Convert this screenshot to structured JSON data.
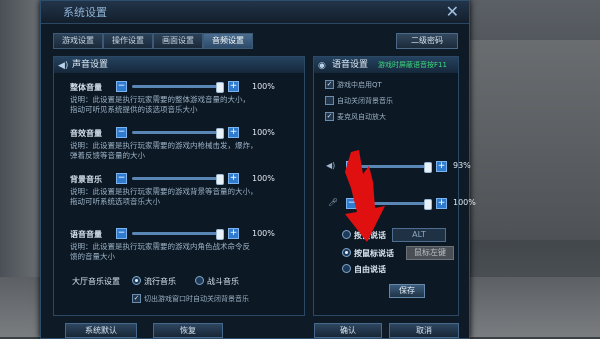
{
  "window": {
    "title": "系统设置"
  },
  "tabs": [
    {
      "label": "游戏设置"
    },
    {
      "label": "操作设置"
    },
    {
      "label": "画面设置"
    },
    {
      "label": "音频设置"
    }
  ],
  "secondary_password_button": "二级密码",
  "sound_panel": {
    "title": "声音设置",
    "rows": [
      {
        "label": "整体音量",
        "value": "100%",
        "level": 1.0,
        "desc1": "说明：此设置是执行玩家需要的整体游戏音量的大小，",
        "desc2": "指动可听见系统提供的该选项音乐大小"
      },
      {
        "label": "音效音量",
        "value": "100%",
        "level": 1.0,
        "desc1": "说明：此设置是执行玩家需要的游戏内枪械击发，爆炸，",
        "desc2": "弹着反馈等音量的大小"
      },
      {
        "label": "背景音乐",
        "value": "100%",
        "level": 1.0,
        "desc1": "说明：此设置是执行玩家需要的游戏背景等音量的大小，",
        "desc2": "拖动可听系统选项音乐大小"
      },
      {
        "label": "语音音量",
        "value": "100%",
        "level": 1.0,
        "desc1": "说明：此设置是执行玩家需要的游戏内角色战术命令反",
        "desc2": "馈的音量大小"
      }
    ],
    "lobby_music": {
      "label": "大厅音乐设置",
      "options": [
        "流行音乐",
        "战斗音乐"
      ],
      "selected": "流行音乐"
    },
    "auto_bgm_off": {
      "label": "切出游戏窗口时自动关闭背景音乐",
      "checked": true
    }
  },
  "voice_panel": {
    "title": "语音设置",
    "hint": "游戏时屏蔽语音按F11",
    "checkboxes": [
      {
        "label": "游戏中启用QT",
        "checked": true
      },
      {
        "label": "自动关闭背景音乐",
        "checked": false
      },
      {
        "label": "麦克风自动放大",
        "checked": true
      }
    ],
    "speaker_volume": {
      "value": "93%",
      "level": 0.93
    },
    "mic_volume": {
      "value": "100%",
      "level": 1.0
    },
    "talk_modes": [
      {
        "label": "按键说话",
        "key": "ALT"
      },
      {
        "label": "按鼠标说话",
        "key": "鼠标左键"
      },
      {
        "label": "自由说话",
        "key": ""
      }
    ],
    "selected_mode": "按鼠标说话",
    "save_label": "保存"
  },
  "footer": {
    "default_label": "系统默认",
    "restore_label": "恢复",
    "confirm_label": "确认",
    "cancel_label": "取消"
  },
  "colors": {
    "accent": "#2f7bd0",
    "hint": "#3dd87a",
    "annotation_arrow": "#e01010"
  }
}
